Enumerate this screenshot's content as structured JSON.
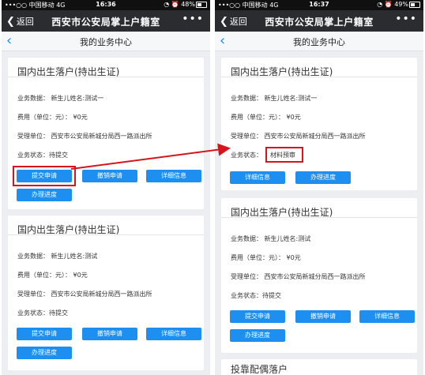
{
  "phones": [
    {
      "statusbar": {
        "carrier": "•••○○ 中国移动",
        "network": "4G",
        "time": "16:36",
        "battery": "48%"
      },
      "titlebar": {
        "back": "返回",
        "title": "西安市公安局掌上户籍室",
        "more": "•••"
      },
      "header": {
        "title": "我的业务中心"
      },
      "cards": [
        {
          "title": "国内出生落户(持出生证)",
          "data": "业务数据：  新生儿姓名:测试一",
          "fee": "费用（单位：元）：  ¥0元",
          "unit": "受理单位：  西安市公安局新城分局西一路派出所",
          "state_label": "业务状态：",
          "state": "待提交",
          "buttons": [
            "提交申请",
            "撤销申请",
            "详细信息",
            "办理进度"
          ]
        },
        {
          "title": "国内出生落户(持出生证)",
          "data": "业务数据：  新生儿姓名:测试",
          "fee": "费用（单位：元）：  ¥0元",
          "unit": "受理单位：  西安市公安局新城分局西一路派出所",
          "state_label": "业务状态：",
          "state": "待提交",
          "buttons": [
            "提交申请",
            "撤销申请",
            "详细信息",
            "办理进度"
          ]
        }
      ]
    },
    {
      "statusbar": {
        "carrier": "•••○○ 中国移动",
        "network": "4G",
        "time": "16:37",
        "battery": "49%"
      },
      "titlebar": {
        "back": "返回",
        "title": "西安市公安局掌上户籍室",
        "more": "•••"
      },
      "header": {
        "title": "我的业务中心"
      },
      "cards": [
        {
          "title": "国内出生落户(持出生证)",
          "data": "业务数据：  新生儿姓名:测试一",
          "fee": "费用（单位：元）：  ¥0元",
          "unit": "受理单位：  西安市公安局新城分局西一路派出所",
          "state_label": "业务状态：",
          "state": "材料预审",
          "buttons": [
            "详细信息",
            "办理进度"
          ]
        },
        {
          "title": "国内出生落户(持出生证)",
          "data": "业务数据：  新生儿姓名:测试",
          "fee": "费用（单位：元）：  ¥0元",
          "unit": "受理单位：  西安市公安局新城分局西一路派出所",
          "state_label": "业务状态：",
          "state": "待提交",
          "buttons": [
            "提交申请",
            "撤销申请",
            "详细信息",
            "办理进度"
          ]
        },
        {
          "title": "投靠配偶落户"
        }
      ]
    }
  ],
  "colors": {
    "accent": "#1d8ff0",
    "highlight": "#d6141b",
    "titlebar": "#2b2c30"
  }
}
